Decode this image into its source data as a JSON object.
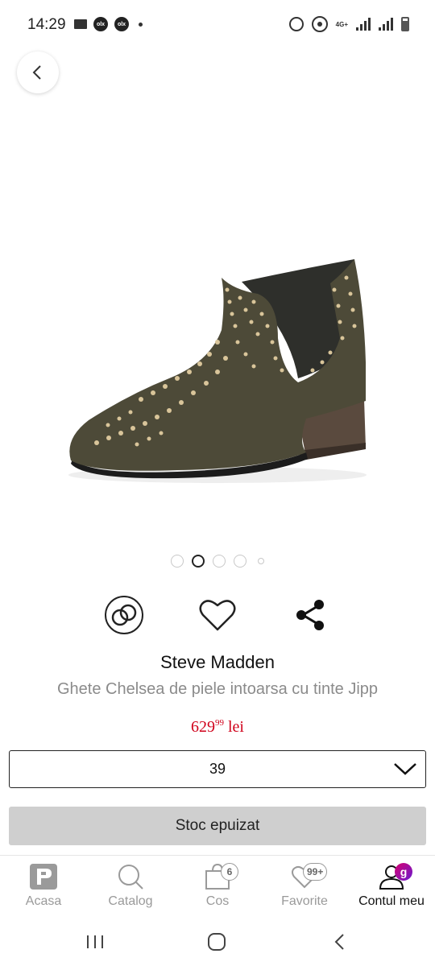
{
  "status_bar": {
    "time": "14:29",
    "network": "4G+"
  },
  "product": {
    "brand": "Steve Madden",
    "name": "Ghete Chelsea de piele intoarsa cu tinte Jipp",
    "price_main": "629",
    "price_cents": "99",
    "price_currency": "lei",
    "selected_size": "39",
    "stock_button": "Stoc epuizat",
    "image_count": 5,
    "active_image": 2
  },
  "bottom_nav": {
    "items": [
      {
        "label": "Acasa"
      },
      {
        "label": "Catalog"
      },
      {
        "label": "Cos",
        "badge": "6"
      },
      {
        "label": "Favorite",
        "badge": "99+"
      },
      {
        "label": "Contul meu",
        "badge": "g"
      }
    ]
  },
  "colors": {
    "price": "#d0021b",
    "disabled_button": "#cfcfcf",
    "muted_text": "#8b8b8b",
    "account_badge_start": "#d6006f",
    "account_badge_end": "#6a1bd0"
  }
}
